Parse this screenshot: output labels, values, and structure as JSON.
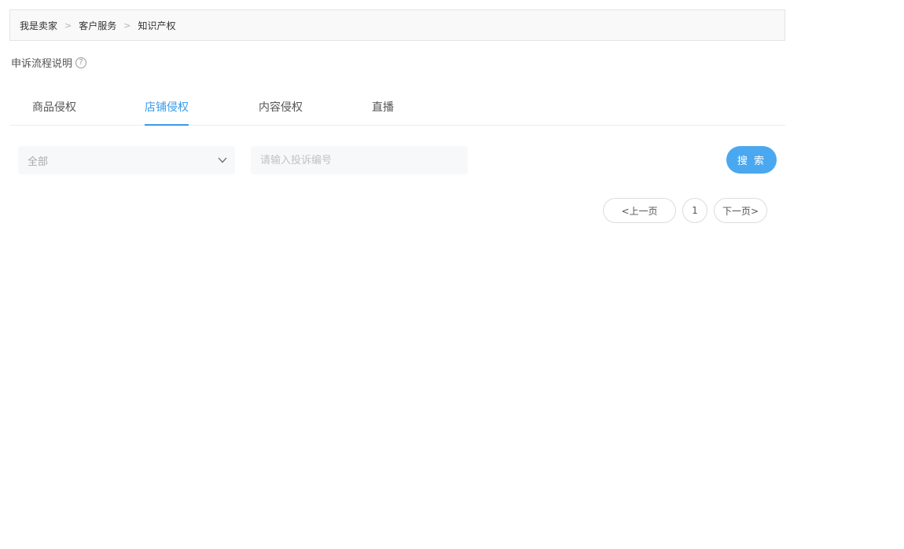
{
  "breadcrumb": {
    "items": [
      "我是卖家",
      "客户服务",
      "知识产权"
    ],
    "separator": ">"
  },
  "help": {
    "label": "申诉流程说明",
    "icon": "question-circle-icon",
    "icon_glyph": "?"
  },
  "tabs": [
    {
      "label": "商品侵权"
    },
    {
      "label": "店铺侵权"
    },
    {
      "label": "内容侵权"
    },
    {
      "label": "直播"
    }
  ],
  "active_tab": "店铺侵权",
  "filters": {
    "select_value": "全部",
    "input_placeholder": "请输入投诉编号",
    "input_value": ""
  },
  "search_label": "搜 索",
  "pagination": {
    "prev_label": "<上一页",
    "current_page": "1",
    "next_label": "下一页>"
  },
  "colors": {
    "accent": "#3b9ae8",
    "button": "#4aa8f0",
    "breadcrumb_bg": "#f9f9f9",
    "field_bg": "#f7f8fa"
  }
}
